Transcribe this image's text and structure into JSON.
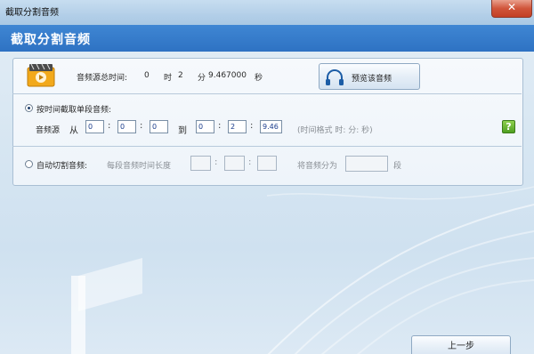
{
  "window": {
    "title": "截取分割音频",
    "close_glyph": "✕"
  },
  "header": {
    "title": "截取分割音频"
  },
  "info": {
    "duration_label": "音频源总时间:",
    "hours": "0",
    "hour_unit": "时",
    "minutes": "2",
    "minute_unit": "分",
    "seconds": "9.467000",
    "second_unit": "秒"
  },
  "preview_button": {
    "label": "预览该音频",
    "icon": "headphones-icon"
  },
  "mode_time": {
    "label": "按时间截取单段音频:",
    "selected": true,
    "source_label": "音频源",
    "from_label": "从",
    "to_label": "到",
    "start": {
      "h": "0",
      "m": "0",
      "s": "0"
    },
    "end": {
      "h": "0",
      "m": "2",
      "s": "9.46"
    },
    "format_hint": "(时间格式 时: 分: 秒)"
  },
  "help_button": {
    "label": "?"
  },
  "mode_auto": {
    "label": "自动切割音频:",
    "selected": false,
    "segment_length_label": "每段音频时间长度",
    "split_label": "将音频分为",
    "segments_unit": "段",
    "seg_h": "",
    "seg_m": "",
    "seg_s": "",
    "seg_count": ""
  },
  "back_button": {
    "label": "上一步"
  },
  "colors": {
    "header": "#2e72c3",
    "close": "#c33f25",
    "value_text": "#1b3d8c",
    "help": "#4f9f21"
  }
}
